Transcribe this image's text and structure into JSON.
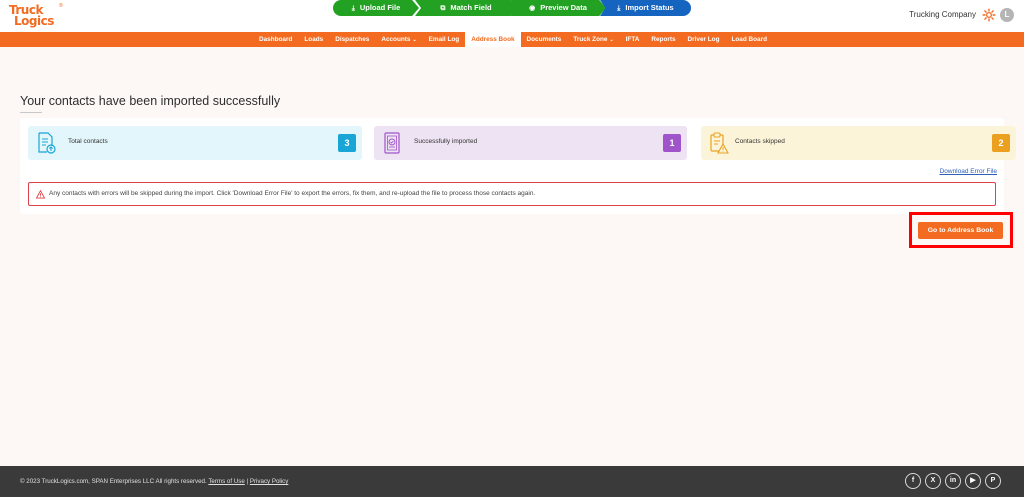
{
  "brand": {
    "logo_top": "Truck",
    "logo_bottom": "Logics",
    "logo_reg": "®"
  },
  "header": {
    "company": "Trucking Company",
    "avatar_initial": "L"
  },
  "nav": {
    "items": [
      {
        "label": "Dashboard",
        "caret": ""
      },
      {
        "label": "Loads",
        "caret": ""
      },
      {
        "label": "Dispatches",
        "caret": ""
      },
      {
        "label": "Accounts",
        "caret": "⌄"
      },
      {
        "label": "Email Log",
        "caret": ""
      },
      {
        "label": "Address Book",
        "caret": ""
      },
      {
        "label": "Documents",
        "caret": ""
      },
      {
        "label": "Truck Zone",
        "caret": "⌄"
      },
      {
        "label": "IFTA",
        "caret": ""
      },
      {
        "label": "Reports",
        "caret": ""
      },
      {
        "label": "Driver Log",
        "caret": ""
      },
      {
        "label": "Load Board",
        "caret": ""
      }
    ],
    "active": "Address Book"
  },
  "stepper": {
    "steps": [
      {
        "label": "Upload File",
        "icon": "download-icon",
        "status": "done",
        "color": "#23a123"
      },
      {
        "label": "Match Field",
        "icon": "match-icon",
        "status": "done",
        "color": "#23a123"
      },
      {
        "label": "Preview Data",
        "icon": "eye-icon",
        "status": "done",
        "color": "#23a123"
      },
      {
        "label": "Import Status",
        "icon": "download-icon",
        "status": "current",
        "color": "#1565c0"
      }
    ]
  },
  "main": {
    "title": "Your contacts have been imported successfully",
    "stats": [
      {
        "label": "Total contacts",
        "count": "3",
        "icon": "document-upload-icon",
        "color": "#19a5d6"
      },
      {
        "label": "Successfully imported",
        "count": "1",
        "icon": "document-check-icon",
        "color": "#a054c9"
      },
      {
        "label": "Contacts skipped",
        "count": "2",
        "icon": "clipboard-warning-icon",
        "color": "#eba020"
      }
    ],
    "download_link": "Download Error File",
    "alert_text": "Any contacts with errors will be skipped during the import. Click 'Download Error File' to export the errors, fix them, and re-upload the file to process those contacts again.",
    "cta_label": "Go to Address Book"
  },
  "footer": {
    "copyright": "© 2023 TruckLogics.com, SPAN Enterprises LLC All rights reserved.",
    "terms": "Terms of Use",
    "separator": "|",
    "privacy": "Privacy Policy",
    "socials": [
      {
        "name": "facebook-icon",
        "glyph": "f"
      },
      {
        "name": "x-icon",
        "glyph": "X"
      },
      {
        "name": "linkedin-icon",
        "glyph": "in"
      },
      {
        "name": "youtube-icon",
        "glyph": "▶"
      },
      {
        "name": "pinterest-icon",
        "glyph": "P"
      }
    ]
  },
  "colors": {
    "accent": "#f26b21",
    "success": "#23a123",
    "current": "#1565c0",
    "error": "#e0404a",
    "highlight": "#ff0000"
  }
}
